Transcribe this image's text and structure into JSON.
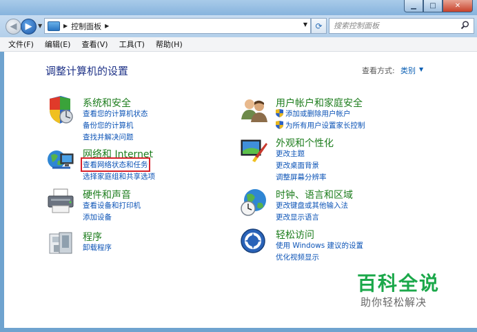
{
  "window": {
    "minimize": "▁",
    "maximize": "□",
    "close": "✕"
  },
  "addressbar": {
    "path": "控制面板",
    "search_placeholder": "搜索控制面板"
  },
  "menu": [
    "文件(F)",
    "编辑(E)",
    "查看(V)",
    "工具(T)",
    "帮助(H)"
  ],
  "content": {
    "title": "调整计算机的设置",
    "view_by_label": "查看方式:",
    "view_by_value": "类别"
  },
  "categories": {
    "system": {
      "title": "系统和安全",
      "links": [
        "查看您的计算机状态",
        "备份您的计算机",
        "查找并解决问题"
      ]
    },
    "network": {
      "title": "网络和 Internet",
      "links": [
        "查看网络状态和任务",
        "选择家庭组和共享选项"
      ]
    },
    "hardware": {
      "title": "硬件和声音",
      "links": [
        "查看设备和打印机",
        "添加设备"
      ]
    },
    "programs": {
      "title": "程序",
      "links": [
        "卸载程序"
      ]
    },
    "users": {
      "title": "用户帐户和家庭安全",
      "links": [
        "添加或删除用户帐户",
        "为所有用户设置家长控制"
      ]
    },
    "appearance": {
      "title": "外观和个性化",
      "links": [
        "更改主题",
        "更改桌面背景",
        "调整屏幕分辨率"
      ]
    },
    "clock": {
      "title": "时钟、语言和区域",
      "links": [
        "更改键盘或其他输入法",
        "更改显示语言"
      ]
    },
    "ease": {
      "title": "轻松访问",
      "links": [
        "使用 Windows 建议的设置",
        "优化视频显示"
      ]
    }
  },
  "watermark": {
    "title": "百科全说",
    "subtitle": "助你轻松解决"
  },
  "colors": {
    "link": "#0b53b6",
    "category_title": "#1d7d1d",
    "highlight": "#d8202a",
    "watermark": "#1ba84a"
  }
}
